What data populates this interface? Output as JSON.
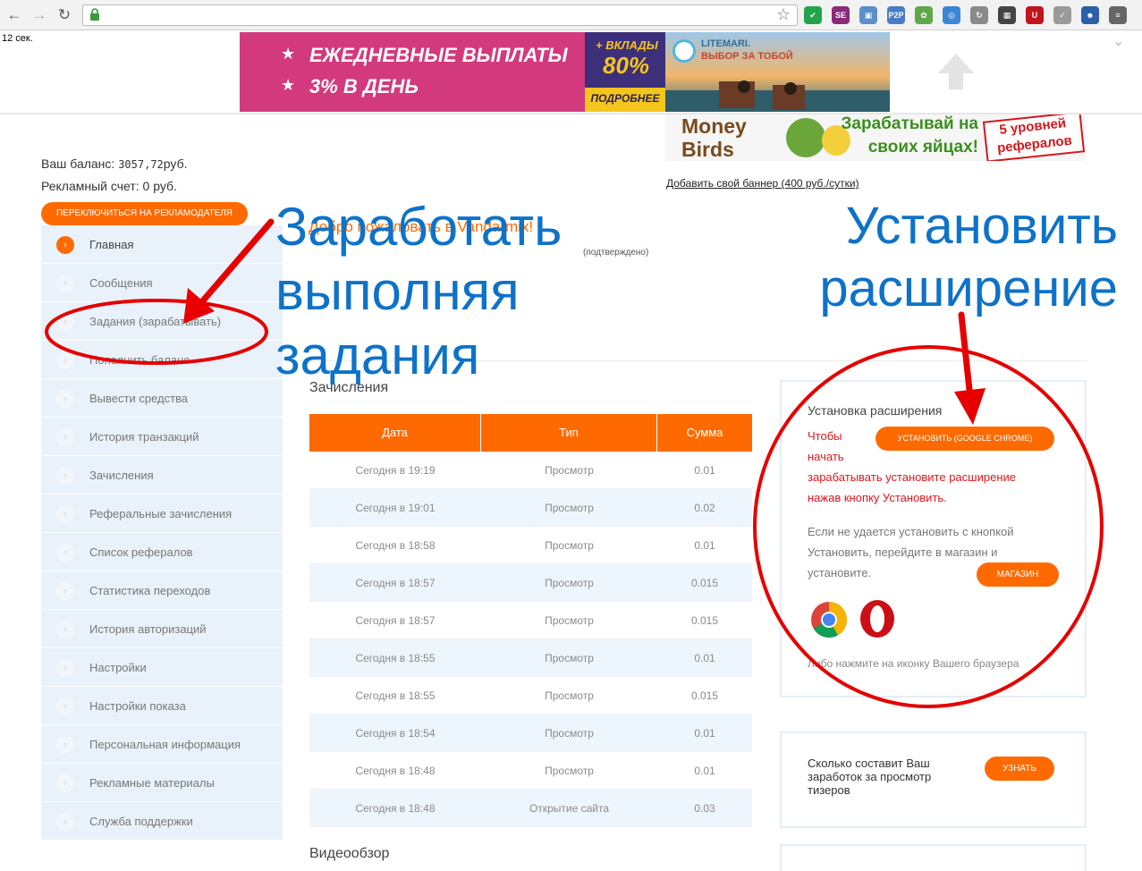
{
  "browser": {
    "back_icon": "back-arrow-icon",
    "forward_icon": "forward-arrow-icon",
    "reload_icon": "reload-icon",
    "lock_icon": "lock-icon",
    "star_icon": "bookmark-star-icon",
    "extensions": [
      {
        "name": "green-check-icon",
        "label": "✔",
        "color": "#24a44a"
      },
      {
        "name": "se-icon",
        "label": "SE",
        "color": "#8a2b7a"
      },
      {
        "name": "monitor-icon",
        "label": "▣",
        "color": "#5b8fc9"
      },
      {
        "name": "p2p-icon",
        "label": "P2P",
        "color": "#4a7cc4"
      },
      {
        "name": "leaf-icon",
        "label": "✿",
        "color": "#5ea84a"
      },
      {
        "name": "globe-icon",
        "label": "◎",
        "color": "#3b87d6"
      },
      {
        "name": "refresh-circle-icon",
        "label": "↻",
        "color": "#8a8a8a"
      },
      {
        "name": "puzzle-icon",
        "label": "▦",
        "color": "#444444"
      },
      {
        "name": "u-icon",
        "label": "U",
        "color": "#c4121f"
      },
      {
        "name": "tick-icon",
        "label": "✓",
        "color": "#9a9a9a"
      },
      {
        "name": "user-icon",
        "label": "☻",
        "color": "#2b5fa8"
      },
      {
        "name": "menu-icon",
        "label": "≡",
        "color": "#666666"
      }
    ]
  },
  "timer": "12 сек.",
  "banners": {
    "ad1_line1": "ЕЖЕДНЕВНЫЕ ВЫПЛАТЫ",
    "ad1_line2": "3% В ДЕНЬ",
    "ad1_badge1": "+ ВКЛАДЫ",
    "ad1_badge2": "80%",
    "ad1_more": "ПОДРОБНЕЕ",
    "ad2_line1": "LITEMARI.",
    "ad2_line2": "ВЫБОР ЗА ТОБОЙ",
    "ad3_brand1": "Money",
    "ad3_brand2": "Birds",
    "ad3_text": "Зарабатывай на своих яйцах!",
    "ad3_badge": "5 уровней рефералов",
    "add_banner": "Добавить свой баннер (400 руб./сутки)"
  },
  "account": {
    "balance_label": "Ваш баланс:",
    "balance_value": "3057,72",
    "balance_currency": "руб.",
    "ad_account": "Рекламный счет: 0 руб.",
    "switch_button": "ПЕРЕКЛЮЧИТЬСЯ НА РЕКЛАМОДАТЕЛЯ"
  },
  "sidebar": {
    "items": [
      {
        "label": "Главная",
        "active": true
      },
      {
        "label": "Сообщения"
      },
      {
        "label": "Задания (зарабатывать)"
      },
      {
        "label": "Пополнить баланс"
      },
      {
        "label": "Вывести средства"
      },
      {
        "label": "История транзакций"
      },
      {
        "label": "Зачисления"
      },
      {
        "label": "Реферальные зачисления"
      },
      {
        "label": "Список рефералов"
      },
      {
        "label": "Статистика переходов"
      },
      {
        "label": "История авторизаций"
      },
      {
        "label": "Настройки"
      },
      {
        "label": "Настройки показа"
      },
      {
        "label": "Персональная информация"
      },
      {
        "label": "Рекламные материалы"
      },
      {
        "label": "Служба поддержки"
      }
    ]
  },
  "main": {
    "welcome": "Добро пожаловать в Vandarmix!",
    "ghost_text": "(подтверждено)",
    "credits_title": "Зачисления",
    "table_headers": [
      "Дата",
      "Тип",
      "Сумма"
    ],
    "rows": [
      [
        "Сегодня в 19:19",
        "Просмотр",
        "0.01"
      ],
      [
        "Сегодня в 19:01",
        "Просмотр",
        "0.02"
      ],
      [
        "Сегодня в 18:58",
        "Просмотр",
        "0.01"
      ],
      [
        "Сегодня в 18:57",
        "Просмотр",
        "0.015"
      ],
      [
        "Сегодня в 18:57",
        "Просмотр",
        "0.015"
      ],
      [
        "Сегодня в 18:55",
        "Просмотр",
        "0.01"
      ],
      [
        "Сегодня в 18:55",
        "Просмотр",
        "0.015"
      ],
      [
        "Сегодня в 18:54",
        "Просмотр",
        "0.01"
      ],
      [
        "Сегодня в 18:48",
        "Просмотр",
        "0.01"
      ],
      [
        "Сегодня в 18:48",
        "Открытие сайта",
        "0.03"
      ]
    ],
    "video_title": "Видеообзор"
  },
  "extension_panel": {
    "title": "Установка расширения",
    "red_line1": "Чтобы",
    "red_line2": "начать",
    "red_line3": "зарабатывать установите расширение",
    "red_line4": "нажав кнопку Установить.",
    "install_button": "УСТАНОВИТЬ (GOOGLE CHROME)",
    "gray_text": "Если не удается установить с кнопкой Установить, перейдите в магазин и установите.",
    "store_button": "МАГАЗИН",
    "hint": "Либо нажмите на иконку Вашего браузера"
  },
  "earnings_panel": {
    "text": "Сколько составит Ваш заработок за просмотр тизеров",
    "button": "УЗНАТЬ"
  },
  "annotations": {
    "left_line1": "Заработать",
    "left_line2": "выполняя",
    "left_line3": "задания",
    "right_line1": "Установить",
    "right_line2": "расширение",
    "color": "#0e72c8",
    "marker_color": "#e60000"
  }
}
